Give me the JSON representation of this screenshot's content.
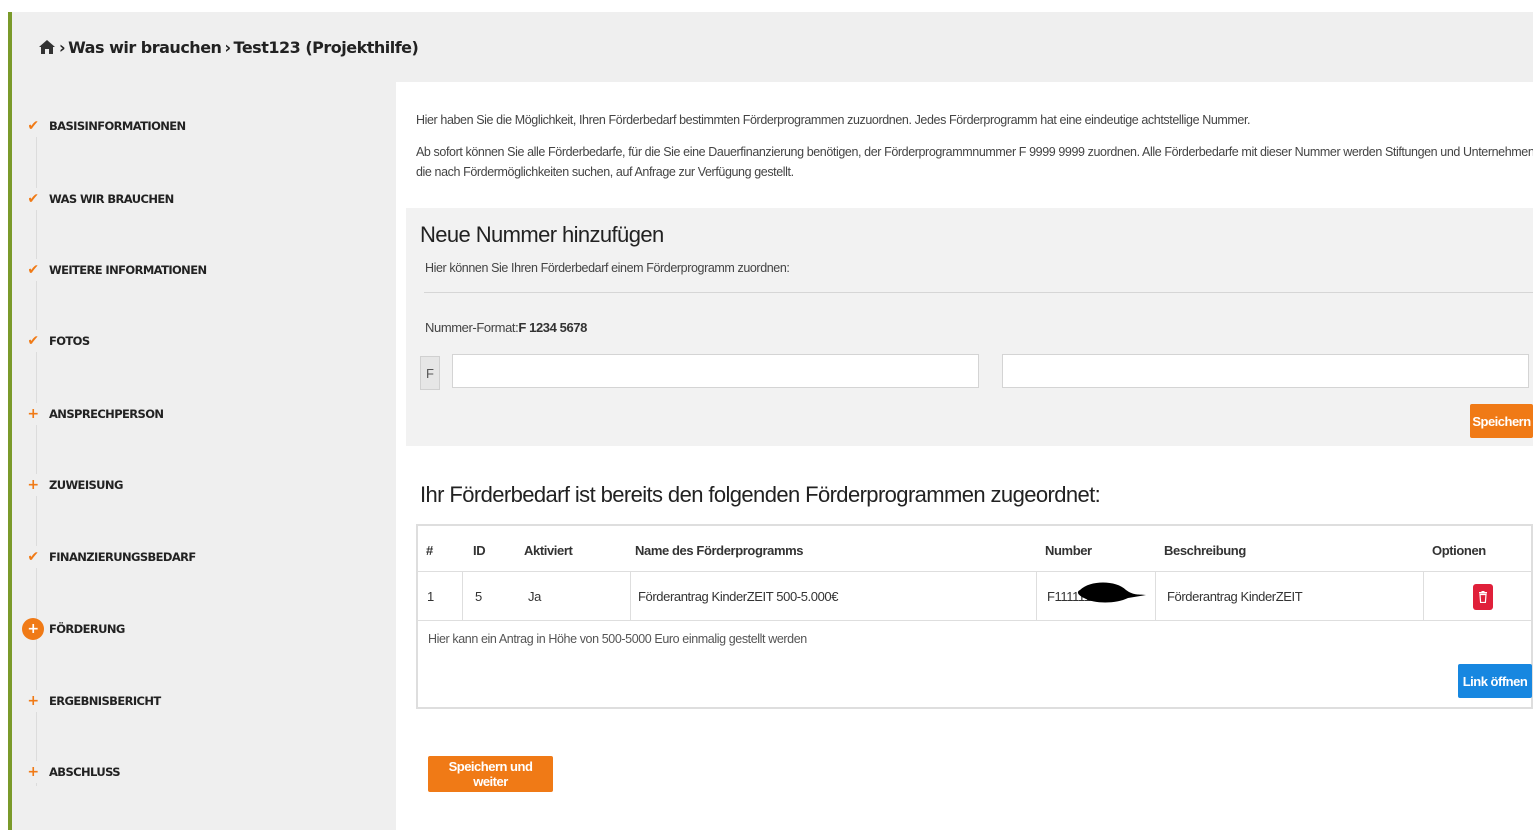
{
  "breadcrumb": {
    "home_icon": "home-icon",
    "items": [
      "Was wir brauchen",
      "Test123 (Projekthilfe)"
    ],
    "separator": "›"
  },
  "colors": {
    "accent": "#f07a16",
    "frame": "#7a9a2a",
    "link_button": "#1787e0",
    "delete_button": "#e0203a"
  },
  "sidebar": {
    "steps": [
      {
        "label": "BASISINFORMATIONEN",
        "status": "done",
        "icon": "check-icon"
      },
      {
        "label": "WAS WIR BRAUCHEN",
        "status": "done",
        "icon": "check-icon"
      },
      {
        "label": "WEITERE INFORMATIONEN",
        "status": "done",
        "icon": "check-icon"
      },
      {
        "label": "FOTOS",
        "status": "done",
        "icon": "check-icon"
      },
      {
        "label": "ANSPRECHPERSON",
        "status": "open",
        "icon": "plus-icon"
      },
      {
        "label": "ZUWEISUNG",
        "status": "open",
        "icon": "plus-icon"
      },
      {
        "label": "FINANZIERUNGSBEDARF",
        "status": "done",
        "icon": "check-icon"
      },
      {
        "label": "FÖRDERUNG",
        "status": "active",
        "icon": "plus-icon"
      },
      {
        "label": "ERGEBNISBERICHT",
        "status": "open",
        "icon": "plus-icon"
      },
      {
        "label": "ABSCHLUSS",
        "status": "open",
        "icon": "plus-icon"
      }
    ]
  },
  "intro": {
    "p1": "Hier haben Sie die Möglichkeit, Ihren Förderbedarf bestimmten Förderprogrammen zuzuordnen. Jedes Förderprogramm hat eine eindeutige achtstellige Nummer.",
    "p2": "Ab sofort können Sie alle Förderbedarfe, für die Sie eine Dauerfinanzierung benötigen, der Förderprogrammnummer F 9999 9999 zuordnen. Alle Förderbedarfe mit dieser Nummer werden Stiftungen und Unternehmen, die nach Fördermöglichkeiten suchen, auf Anfrage zur Verfügung gestellt."
  },
  "add_panel": {
    "title": "Neue Nummer hinzufügen",
    "subtitle": "Hier können Sie Ihren Förderbedarf einem Förderprogramm zuordnen:",
    "format_label": "Nummer-Format:",
    "format_value": "F 1234 5678",
    "prefix": "F",
    "input1_value": "",
    "input2_value": "",
    "save_label": "Speichern"
  },
  "assigned": {
    "title": "Ihr Förderbedarf ist bereits den folgenden Förderprogrammen zugeordnet:",
    "columns": [
      "#",
      "ID",
      "Aktiviert",
      "Name des Förderprogramms",
      "Number",
      "Beschreibung",
      "Optionen"
    ],
    "rows": [
      {
        "index": "1",
        "id": "5",
        "activated": "Ja",
        "name": "Förderantrag KinderZEIT 500-5.000€",
        "number": "F1111111",
        "description": "Förderantrag KinderZEIT",
        "delete_icon": "trash-icon",
        "details": "Hier kann ein Antrag in Höhe von 500-5000 Euro einmalig gestellt werden",
        "link_label": "Link öffnen"
      }
    ]
  },
  "footer": {
    "next_label": "Speichern und weiter"
  }
}
